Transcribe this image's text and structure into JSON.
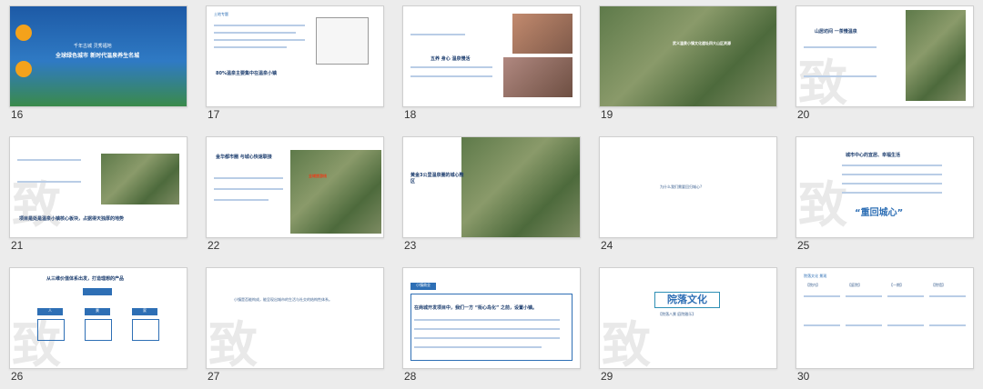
{
  "slides": [
    {
      "num": "16",
      "t1": "全球绿色城市 新时代温泉养生名城",
      "t2": "千年古城 灵秀福地"
    },
    {
      "num": "17",
      "t1": "80%温泉主要集中在温泉小镇"
    },
    {
      "num": "18",
      "t1": "五养 身心 温泉慢活"
    },
    {
      "num": "19",
      "t1": "武义温泉小镇文化遗址四大山区资源"
    },
    {
      "num": "20",
      "t1": "山居坊间 一茶慢温泉"
    },
    {
      "num": "21",
      "t1": "项目是处是温泉小镇核心板块，占据得天独厚的地势"
    },
    {
      "num": "22",
      "t1": "金华都市圈 与城心快速联接",
      "t2": "全域旅游线"
    },
    {
      "num": "23",
      "t1": "黄金3公里温泉圈的城心整区"
    },
    {
      "num": "24",
      "t1": "为什么我们需要回归城心?"
    },
    {
      "num": "25",
      "t1": "城市中心的宜居、幸福生活",
      "t2": "“重回城心”"
    },
    {
      "num": "26",
      "t1": "从三维价值体系出发，打造理想的产品",
      "nodes": [
        "人",
        "景",
        "家"
      ]
    },
    {
      "num": "27",
      "t1": "小镇是否能构成，能呈现出城市的生活与社交的结构性体系。"
    },
    {
      "num": "28",
      "t1": "在商城开发项目中，我们一方 “街心岛化” 之前，设置小镇。",
      "t2": "小镇商业"
    },
    {
      "num": "29",
      "t1": "院落文化",
      "t2": "【院落八景 庭院雅乐】"
    },
    {
      "num": "30",
      "t1": "院落文化 景观",
      "labels": [
        "【院内】",
        "【庭院】",
        "【一期】",
        "【院墙】"
      ]
    }
  ]
}
